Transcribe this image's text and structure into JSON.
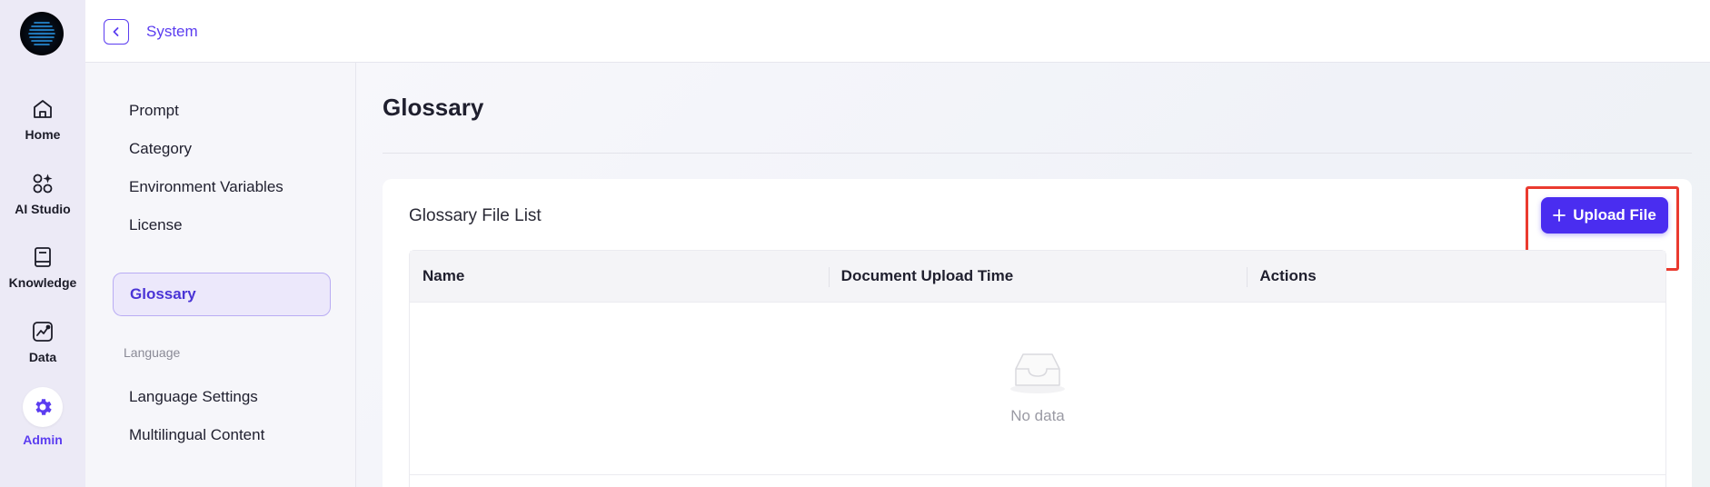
{
  "rail": {
    "items": [
      {
        "label": "Home",
        "icon": "home-icon"
      },
      {
        "label": "AI Studio",
        "icon": "apps-sparkle-icon"
      },
      {
        "label": "Knowledge",
        "icon": "book-icon"
      },
      {
        "label": "Data",
        "icon": "chart-icon"
      },
      {
        "label": "Admin",
        "icon": "gear-icon",
        "active": true
      }
    ]
  },
  "topbar": {
    "back_icon": "chevron-left-icon",
    "title": "System"
  },
  "subnav": {
    "items": [
      "Prompt",
      "Category",
      "Environment Variables",
      "License",
      "Glossary"
    ],
    "active": "Glossary",
    "group_label": "Language",
    "group_items": [
      "Language Settings",
      "Multilingual Content"
    ]
  },
  "main": {
    "title": "Glossary",
    "card_title": "Glossary File List",
    "upload_button": "Upload File",
    "table": {
      "columns": [
        "Name",
        "Document Upload Time",
        "Actions"
      ],
      "rows": [],
      "empty_text": "No data"
    }
  },
  "colors": {
    "accent": "#5b3df0",
    "button": "#4a2df0",
    "highlight": "#ea3a2f"
  }
}
